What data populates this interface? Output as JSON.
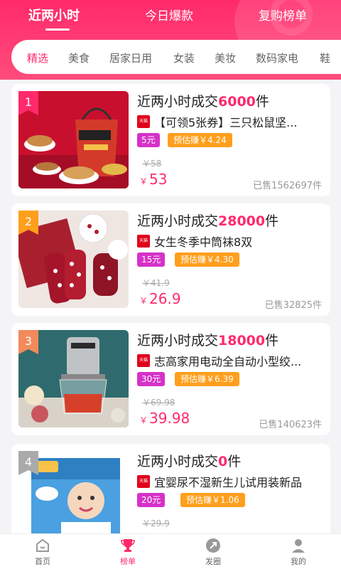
{
  "header": {
    "tabs": [
      {
        "label": "近两小时",
        "active": true
      },
      {
        "label": "今日爆款",
        "active": false
      },
      {
        "label": "复购榜单",
        "active": false
      }
    ]
  },
  "categories": [
    "精选",
    "美食",
    "居家日用",
    "女装",
    "美妆",
    "数码家电",
    "鞋"
  ],
  "products": [
    {
      "rank": "1",
      "title_prefix": "近两小时成交",
      "count": "6000",
      "unit": "件",
      "name": "【可领5张券】三只松鼠坚...",
      "coupon": "5元",
      "earn": "预估赚￥4.24",
      "orig_price": "￥58",
      "price": "53",
      "sold": "已售1562697件",
      "rank_color": "#ff2a6a"
    },
    {
      "rank": "2",
      "title_prefix": "近两小时成交",
      "count": "28000",
      "unit": "件",
      "name": "女生冬季中筒袜8双",
      "coupon": "15元",
      "earn": "预估赚￥4.30",
      "orig_price": "￥41.9",
      "price": "26.9",
      "sold": "已售32825件",
      "rank_color": "#ff9f1c"
    },
    {
      "rank": "3",
      "title_prefix": "近两小时成交",
      "count": "18000",
      "unit": "件",
      "name": "志高家用电动全自动小型绞...",
      "coupon": "30元",
      "earn": "预估赚￥6.39",
      "orig_price": "￥69.98",
      "price": "39.98",
      "sold": "已售140623件",
      "rank_color": "#f28a5c"
    },
    {
      "rank": "4",
      "title_prefix": "近两小时成交",
      "count": "0",
      "unit": "件",
      "name": "宜婴尿不湿新生儿试用装新品",
      "coupon": "20元",
      "earn": "预估赚￥1.06",
      "orig_price": "￥29.9",
      "price": "",
      "sold": "",
      "rank_color": "#aaaaaa"
    }
  ],
  "bottom_nav": [
    {
      "label": "首页",
      "icon": "home-icon",
      "active": false
    },
    {
      "label": "榜单",
      "icon": "trophy-icon",
      "active": true
    },
    {
      "label": "发圈",
      "icon": "share-icon",
      "active": false
    },
    {
      "label": "我的",
      "icon": "user-icon",
      "active": false
    }
  ],
  "colors": {
    "accent": "#ff2a6a",
    "coupon": "#d631c8",
    "earn": "#ff9f1c",
    "tmall": "#e0001b"
  }
}
